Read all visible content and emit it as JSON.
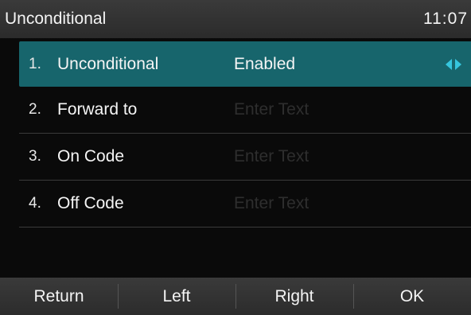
{
  "header": {
    "title": "Unconditional",
    "time": "11:07"
  },
  "rows": [
    {
      "number": "1.",
      "label": "Unconditional",
      "value": "Enabled",
      "placeholder": "",
      "selected": true
    },
    {
      "number": "2.",
      "label": "Forward to",
      "value": "",
      "placeholder": "Enter Text",
      "selected": false
    },
    {
      "number": "3.",
      "label": "On Code",
      "value": "",
      "placeholder": "Enter Text",
      "selected": false
    },
    {
      "number": "4.",
      "label": "Off Code",
      "value": "",
      "placeholder": "Enter Text",
      "selected": false
    }
  ],
  "softkeys": {
    "return": "Return",
    "left": "Left",
    "right": "Right",
    "ok": "OK"
  },
  "colors": {
    "selection": "#17656c",
    "arrow": "#36c6de",
    "background": "#0a0a0a",
    "placeholder": "#2e2e2e"
  }
}
